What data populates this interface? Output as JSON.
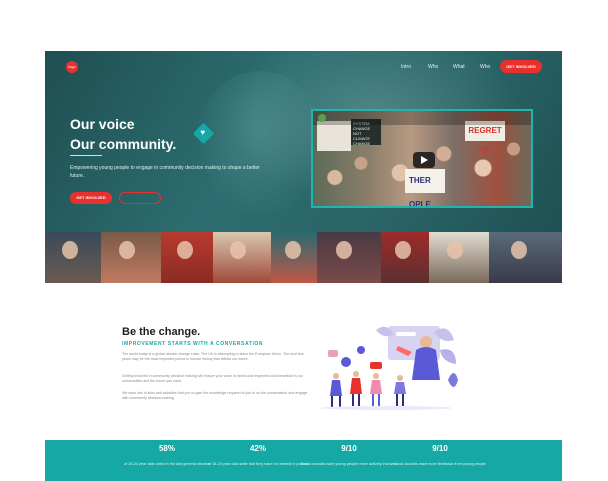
{
  "header": {
    "logo_text": "logo",
    "nav": [
      "Intro",
      "Who",
      "What",
      "Who"
    ],
    "cta": "GET INVOLVED"
  },
  "hero": {
    "headline_line1": "Our voice",
    "headline_line2": "Our community.",
    "subtext": "Empowering young people to engage in community decision making to shape a better future.",
    "primary_button": "GET INVOLVED",
    "secondary_button": "",
    "video": {
      "sign_text_1": "SYSTEM CHANGE NOT CLIMATE CHANGE",
      "sign_text_2": "REGRET IT",
      "sign_text_3": "THER OPLE"
    }
  },
  "change_section": {
    "title": "Be the change.",
    "subtitle": "IMPROVEMENT STARTS WITH A CONVERSATION",
    "paragraphs": [
      "The world today is a global climate change crisis. The UK is attempting to leave the European Union. The next few years may be the most important period in human history that affects our future.",
      "Getting involved in community decision making will ensure your voice is heard and respected and beneficial in our communities and the future you want.",
      "We have lots of links and activities that you to gain the knowledge required to join in on the conversation and engage with community decision-making."
    ]
  },
  "stats": [
    {
      "value": "58%",
      "label": "of 18-24 year olds voted in the last general election"
    },
    {
      "value": "42%",
      "label": "of 18-24 year olds state that they have no interest in politics"
    },
    {
      "value": "9/10",
      "label": "Local councils want young people more actively involved"
    },
    {
      "value": "9/10",
      "label": "Local councils want more feedback from young people"
    }
  ],
  "colors": {
    "accent_red": "#e8312f",
    "teal": "#15a8a4",
    "hero_overlay": "#2c6d70"
  }
}
